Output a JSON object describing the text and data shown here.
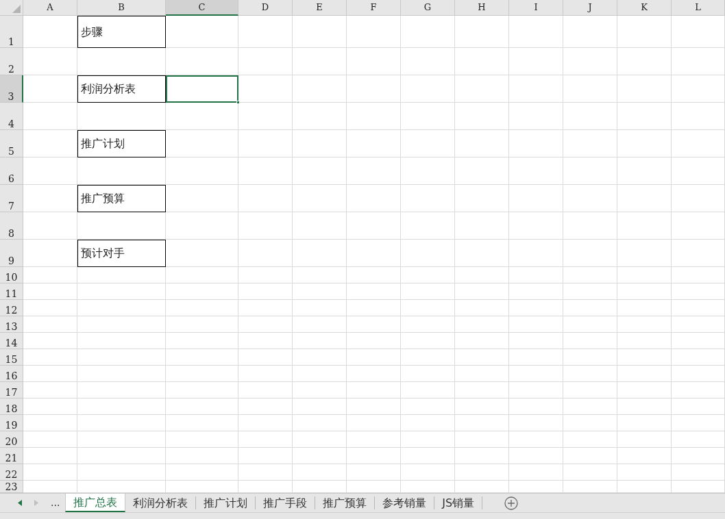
{
  "columns": [
    {
      "label": "A",
      "selected": false
    },
    {
      "label": "B",
      "selected": false
    },
    {
      "label": "C",
      "selected": true
    },
    {
      "label": "D",
      "selected": false
    },
    {
      "label": "E",
      "selected": false
    },
    {
      "label": "F",
      "selected": false
    },
    {
      "label": "G",
      "selected": false
    },
    {
      "label": "H",
      "selected": false
    },
    {
      "label": "I",
      "selected": false
    },
    {
      "label": "J",
      "selected": false
    },
    {
      "label": "K",
      "selected": false
    },
    {
      "label": "L",
      "selected": false
    }
  ],
  "rows": [
    {
      "label": "1",
      "selected": false,
      "kind": "first",
      "text": "步骤"
    },
    {
      "label": "2",
      "selected": false,
      "kind": "tall"
    },
    {
      "label": "3",
      "selected": true,
      "kind": "tall",
      "text": "利润分析表"
    },
    {
      "label": "4",
      "selected": false,
      "kind": "tall"
    },
    {
      "label": "5",
      "selected": false,
      "kind": "tall",
      "text": "推广计划"
    },
    {
      "label": "6",
      "selected": false,
      "kind": "tall"
    },
    {
      "label": "7",
      "selected": false,
      "kind": "tall",
      "text": "推广预算"
    },
    {
      "label": "8",
      "selected": false,
      "kind": "tall"
    },
    {
      "label": "9",
      "selected": false,
      "kind": "tall",
      "text": "预计对手"
    },
    {
      "label": "10",
      "selected": false,
      "kind": "normal"
    },
    {
      "label": "11",
      "selected": false,
      "kind": "normal"
    },
    {
      "label": "12",
      "selected": false,
      "kind": "normal"
    },
    {
      "label": "13",
      "selected": false,
      "kind": "normal"
    },
    {
      "label": "14",
      "selected": false,
      "kind": "normal"
    },
    {
      "label": "15",
      "selected": false,
      "kind": "normal"
    },
    {
      "label": "16",
      "selected": false,
      "kind": "normal"
    },
    {
      "label": "17",
      "selected": false,
      "kind": "normal"
    },
    {
      "label": "18",
      "selected": false,
      "kind": "normal"
    },
    {
      "label": "19",
      "selected": false,
      "kind": "normal"
    },
    {
      "label": "20",
      "selected": false,
      "kind": "normal"
    },
    {
      "label": "21",
      "selected": false,
      "kind": "normal"
    },
    {
      "label": "22",
      "selected": false,
      "kind": "normal"
    },
    {
      "label": "23",
      "selected": false,
      "kind": "partial"
    }
  ],
  "sheet_tabs": {
    "more": "...",
    "tabs": [
      {
        "label": "推广总表",
        "selected": true
      },
      {
        "label": "利润分析表",
        "selected": false
      },
      {
        "label": "推广计划",
        "selected": false
      },
      {
        "label": "推广手段",
        "selected": false
      },
      {
        "label": "推广预算",
        "selected": false
      },
      {
        "label": "参考销量",
        "selected": false
      },
      {
        "label": "JS销量",
        "selected": false
      }
    ]
  }
}
